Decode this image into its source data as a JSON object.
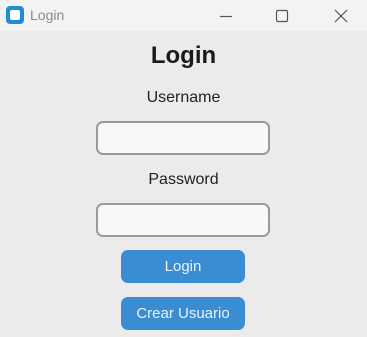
{
  "window": {
    "title": "Login",
    "controls": [
      "minimize",
      "maximize",
      "close"
    ]
  },
  "form": {
    "heading": "Login",
    "username_label": "Username",
    "username_value": "",
    "password_label": "Password",
    "password_value": "",
    "login_button": "Login",
    "create_user_button": "Crear Usuario"
  },
  "colors": {
    "accent": "#3a8dd3",
    "background": "#ebebeb",
    "field_border": "#9a9a9a"
  },
  "icons": {
    "app": "app-icon",
    "minimize": "minimize-icon",
    "maximize": "maximize-icon",
    "close": "close-icon"
  }
}
